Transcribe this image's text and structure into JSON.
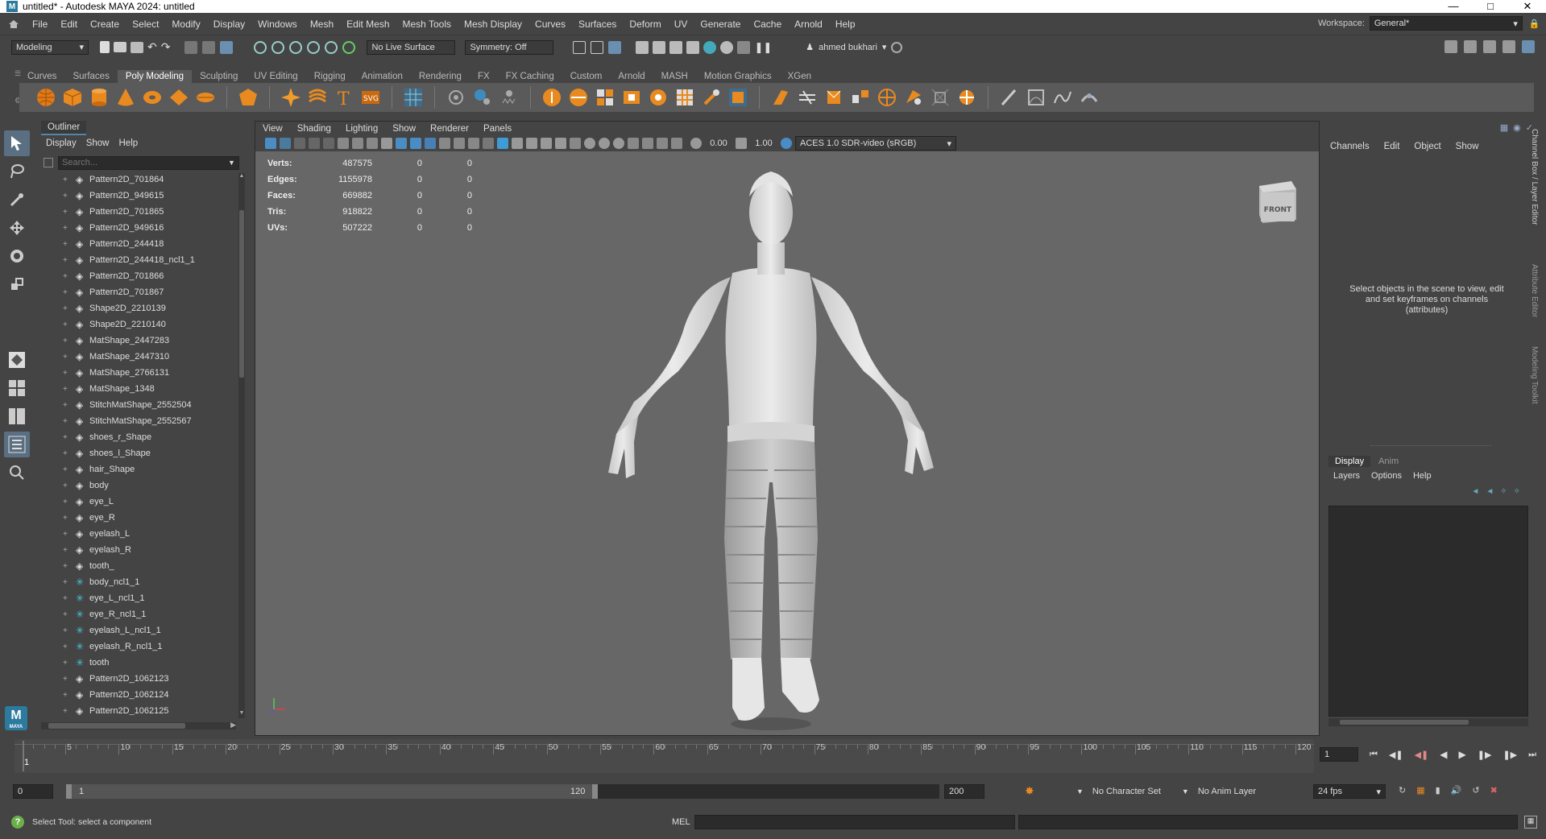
{
  "window": {
    "title": "untitled* - Autodesk MAYA 2024: untitled",
    "app_icon_letter": "M"
  },
  "menus": [
    "File",
    "Edit",
    "Create",
    "Select",
    "Modify",
    "Display",
    "Windows",
    "Mesh",
    "Edit Mesh",
    "Mesh Tools",
    "Mesh Display",
    "Curves",
    "Surfaces",
    "Deform",
    "UV",
    "Generate",
    "Cache",
    "Arnold",
    "Help"
  ],
  "workspace": {
    "label": "Workspace:",
    "value": "General*"
  },
  "statusline": {
    "menuset": "Modeling",
    "live_surface": "No Live Surface",
    "symmetry": "Symmetry: Off",
    "user": "ahmed bukhari"
  },
  "shelf_tabs": [
    "Curves",
    "Surfaces",
    "Poly Modeling",
    "Sculpting",
    "UV Editing",
    "Rigging",
    "Animation",
    "Rendering",
    "FX",
    "FX Caching",
    "Custom",
    "Arnold",
    "MASH",
    "Motion Graphics",
    "XGen"
  ],
  "shelf_active": "Poly Modeling",
  "outliner": {
    "title": "Outliner",
    "menus": [
      "Display",
      "Show",
      "Help"
    ],
    "search_placeholder": "Search...",
    "items": [
      {
        "name": "Pattern2D_701864",
        "type": "mesh"
      },
      {
        "name": "Pattern2D_949615",
        "type": "mesh"
      },
      {
        "name": "Pattern2D_701865",
        "type": "mesh"
      },
      {
        "name": "Pattern2D_949616",
        "type": "mesh"
      },
      {
        "name": "Pattern2D_244418",
        "type": "mesh"
      },
      {
        "name": "Pattern2D_244418_ncl1_1",
        "type": "mesh"
      },
      {
        "name": "Pattern2D_701866",
        "type": "mesh"
      },
      {
        "name": "Pattern2D_701867",
        "type": "mesh"
      },
      {
        "name": "Shape2D_2210139",
        "type": "mesh"
      },
      {
        "name": "Shape2D_2210140",
        "type": "mesh"
      },
      {
        "name": "MatShape_2447283",
        "type": "mesh"
      },
      {
        "name": "MatShape_2447310",
        "type": "mesh"
      },
      {
        "name": "MatShape_2766131",
        "type": "mesh"
      },
      {
        "name": "MatShape_1348",
        "type": "mesh"
      },
      {
        "name": "StitchMatShape_2552504",
        "type": "mesh"
      },
      {
        "name": "StitchMatShape_2552567",
        "type": "mesh"
      },
      {
        "name": "shoes_r_Shape",
        "type": "mesh"
      },
      {
        "name": "shoes_l_Shape",
        "type": "mesh"
      },
      {
        "name": "hair_Shape",
        "type": "mesh"
      },
      {
        "name": "body",
        "type": "mesh"
      },
      {
        "name": "eye_L",
        "type": "mesh"
      },
      {
        "name": "eye_R",
        "type": "mesh"
      },
      {
        "name": "eyelash_L",
        "type": "mesh"
      },
      {
        "name": "eyelash_R",
        "type": "mesh"
      },
      {
        "name": "tooth_",
        "type": "mesh"
      },
      {
        "name": "body_ncl1_1",
        "type": "ncloth"
      },
      {
        "name": "eye_L_ncl1_1",
        "type": "ncloth"
      },
      {
        "name": "eye_R_ncl1_1",
        "type": "ncloth"
      },
      {
        "name": "eyelash_L_ncl1_1",
        "type": "ncloth"
      },
      {
        "name": "eyelash_R_ncl1_1",
        "type": "ncloth"
      },
      {
        "name": "tooth",
        "type": "ncloth"
      },
      {
        "name": "Pattern2D_1062123",
        "type": "mesh"
      },
      {
        "name": "Pattern2D_1062124",
        "type": "mesh"
      },
      {
        "name": "Pattern2D_1062125",
        "type": "mesh"
      }
    ]
  },
  "viewport": {
    "menus": [
      "View",
      "Shading",
      "Lighting",
      "Show",
      "Renderer",
      "Panels"
    ],
    "exposure": "0.00",
    "gamma": "1.00",
    "color_space": "ACES 1.0 SDR-video (sRGB)",
    "view_cube_label": "FRONT",
    "hud": [
      {
        "label": "Verts:",
        "a": "487575",
        "b": "0",
        "c": "0"
      },
      {
        "label": "Edges:",
        "a": "1155978",
        "b": "0",
        "c": "0"
      },
      {
        "label": "Faces:",
        "a": "669882",
        "b": "0",
        "c": "0"
      },
      {
        "label": "Tris:",
        "a": "918822",
        "b": "0",
        "c": "0"
      },
      {
        "label": "UVs:",
        "a": "507222",
        "b": "0",
        "c": "0"
      }
    ]
  },
  "channel_box": {
    "menus": [
      "Channels",
      "Edit",
      "Object",
      "Show"
    ],
    "message": "Select objects in the scene to view, edit and set keyframes on channels (attributes)",
    "side_tabs": [
      "Channel Box / Layer Editor",
      "Attribute Editor",
      "Modeling Toolkit"
    ]
  },
  "layer_editor": {
    "tabs": [
      "Display",
      "Anim"
    ],
    "active_tab": "Display",
    "menus": [
      "Layers",
      "Options",
      "Help"
    ]
  },
  "timeline": {
    "ticks": [
      "5",
      "10",
      "15",
      "20",
      "25",
      "30",
      "35",
      "40",
      "45",
      "50",
      "55",
      "60",
      "65",
      "70",
      "75",
      "80",
      "85",
      "90",
      "95",
      "100",
      "105",
      "110",
      "115",
      "120"
    ],
    "first_label": "1",
    "current_frame": "1"
  },
  "range": {
    "start": "0",
    "range_start": "1",
    "range_end": "120",
    "end": "200",
    "character_set": "No Character Set",
    "anim_layer": "No Anim Layer",
    "fps": "24 fps"
  },
  "help_line": {
    "text": "Select Tool: select a component"
  },
  "command_line": {
    "lang": "MEL"
  }
}
